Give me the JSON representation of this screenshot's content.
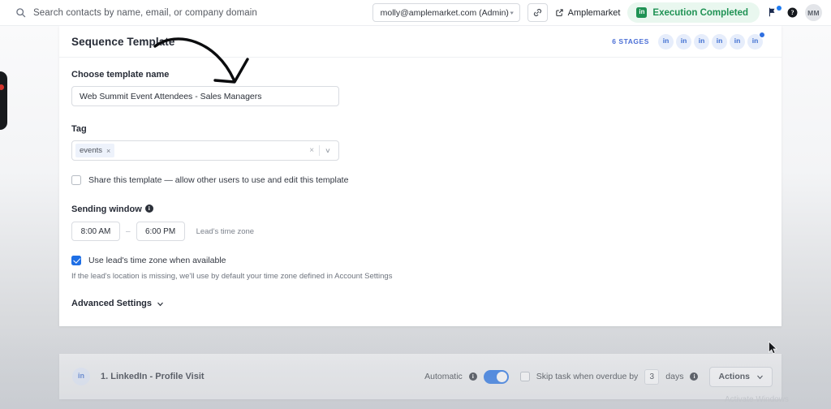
{
  "topbar": {
    "search_placeholder": "Search contacts by name, email, or company domain",
    "search_value": "",
    "search_icon": "search-icon",
    "account": "molly@amplemarket.com (Admin)",
    "account_caret": "▾",
    "link_icon": "link-icon",
    "app_name": "Amplemarket",
    "external_icon": "external-link-icon",
    "status": "Execution Completed",
    "status_icon_label": "in",
    "status_color": "#1f9254",
    "status_bg": "#e9f7ef",
    "flag_icon": "flag-icon",
    "help_icon": "help-circle-icon",
    "avatar_initials": "MM"
  },
  "card": {
    "title": "Sequence Template",
    "stages_label": "6 STAGES",
    "stage_chips": [
      "in",
      "in",
      "in",
      "in",
      "in",
      "in"
    ],
    "template_name_label": "Choose template name",
    "template_name_value": "Web Summit Event Attendees - Sales Managers",
    "tag_label": "Tag",
    "tags": [
      "events"
    ],
    "tag_remove_icon": "×",
    "tag_clear_icon": "×",
    "tag_caret": "∨",
    "share_label": "Share this template — allow other users to use and edit this template",
    "share_checked": false,
    "sending_window_label": "Sending window",
    "sending_window_info": "i",
    "time_start": "8:00 AM",
    "time_dash": "–",
    "time_end": "6:00 PM",
    "timezone_note": "Lead's time zone",
    "use_lead_tz_label": "Use lead's time zone when available",
    "use_lead_tz_checked": true,
    "tz_helper": "If the lead's location is missing, we'll use by default your time zone defined in Account Settings",
    "advanced_settings_label": "Advanced Settings",
    "advanced_caret": "chevron-down-icon"
  },
  "stagebar": {
    "chip_label": "in",
    "title": "1. LinkedIn - Profile Visit",
    "automatic_label": "Automatic",
    "automatic_info": "i",
    "automatic_on": true,
    "skip_label": "Skip task when overdue by",
    "skip_checked": false,
    "skip_days": "3",
    "days_label": "days",
    "days_info": "i",
    "actions_label": "Actions",
    "actions_caret": "chevron-down-icon"
  },
  "watermark": "Activate Windows"
}
